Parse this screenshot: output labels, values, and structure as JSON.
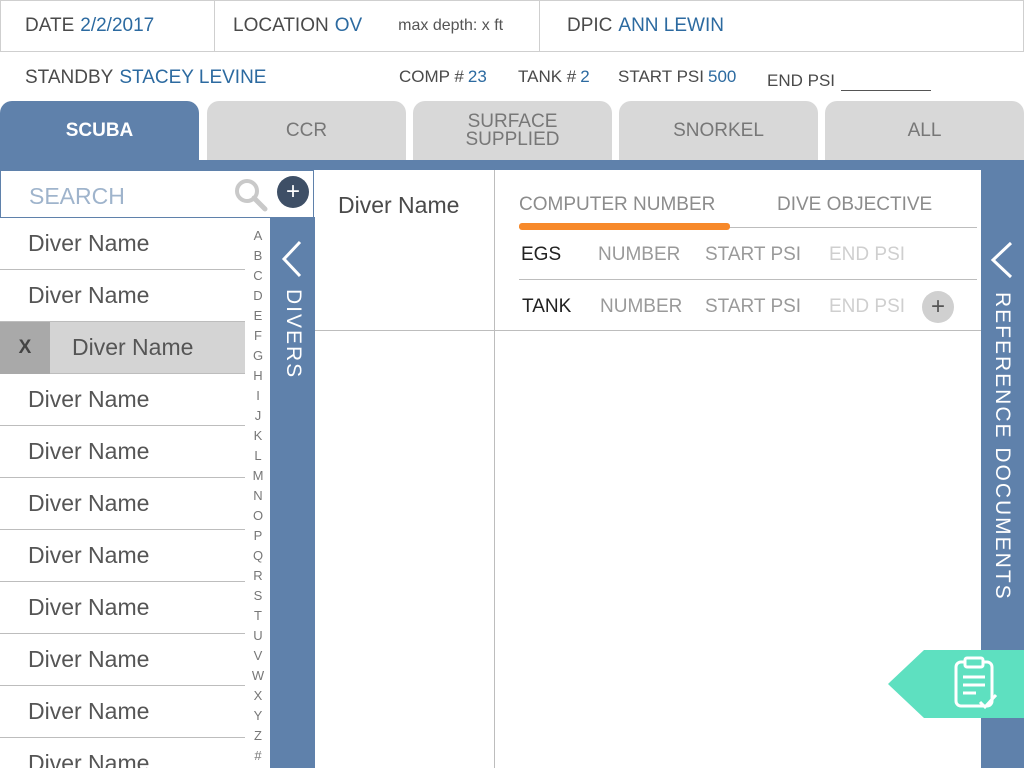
{
  "header": {
    "date_label": "DATE",
    "date_value": "2/2/2017",
    "location_label": "LOCATION",
    "location_value": "OV",
    "max_depth": "max depth: x ft",
    "dpic_label": "DPIC",
    "dpic_value": "ANN LEWIN",
    "standby_label": "STANDBY",
    "standby_value": "STACEY LEVINE",
    "comp_label": "COMP #",
    "comp_value": "23",
    "tank_label": "TANK #",
    "tank_value": "2",
    "start_psi_label": "START PSI",
    "start_psi_value": "500",
    "end_psi_label": "END PSI"
  },
  "tabs": [
    {
      "label": "SCUBA",
      "active": true
    },
    {
      "label": "CCR",
      "active": false
    },
    {
      "label": "SURFACE SUPPLIED",
      "active": false
    },
    {
      "label": "SNORKEL",
      "active": false
    },
    {
      "label": "ALL",
      "active": false
    }
  ],
  "search": {
    "placeholder": "SEARCH",
    "add_icon": "plus-icon",
    "search_icon": "magnifier-icon"
  },
  "divers": [
    "Diver Name",
    "Diver Name",
    "Diver Name",
    "Diver Name",
    "Diver Name",
    "Diver Name",
    "Diver Name",
    "Diver Name",
    "Diver Name",
    "Diver Name",
    "Diver Name"
  ],
  "selected_remove": "X",
  "alphabet": [
    "A",
    "B",
    "C",
    "D",
    "E",
    "F",
    "G",
    "H",
    "I",
    "J",
    "K",
    "L",
    "M",
    "N",
    "O",
    "P",
    "Q",
    "R",
    "S",
    "T",
    "U",
    "V",
    "W",
    "X",
    "Y",
    "Z",
    "#"
  ],
  "divers_panel_label": "DIVERS",
  "detail": {
    "diver_name": "Diver Name",
    "tab_computer": "COMPUTER NUMBER",
    "tab_objective": "DIVE OBJECTIVE",
    "egs_label": "EGS",
    "tank_label": "TANK",
    "number": "NUMBER",
    "start_psi": "START PSI",
    "end_psi": "END PSI",
    "add_icon": "plus-icon"
  },
  "reference_label": "REFERENCE DOCUMENTS",
  "colors": {
    "accent": "#5f81ab",
    "orange": "#f7892a",
    "teal": "#5ee0c0",
    "link": "#2c6aa0"
  }
}
